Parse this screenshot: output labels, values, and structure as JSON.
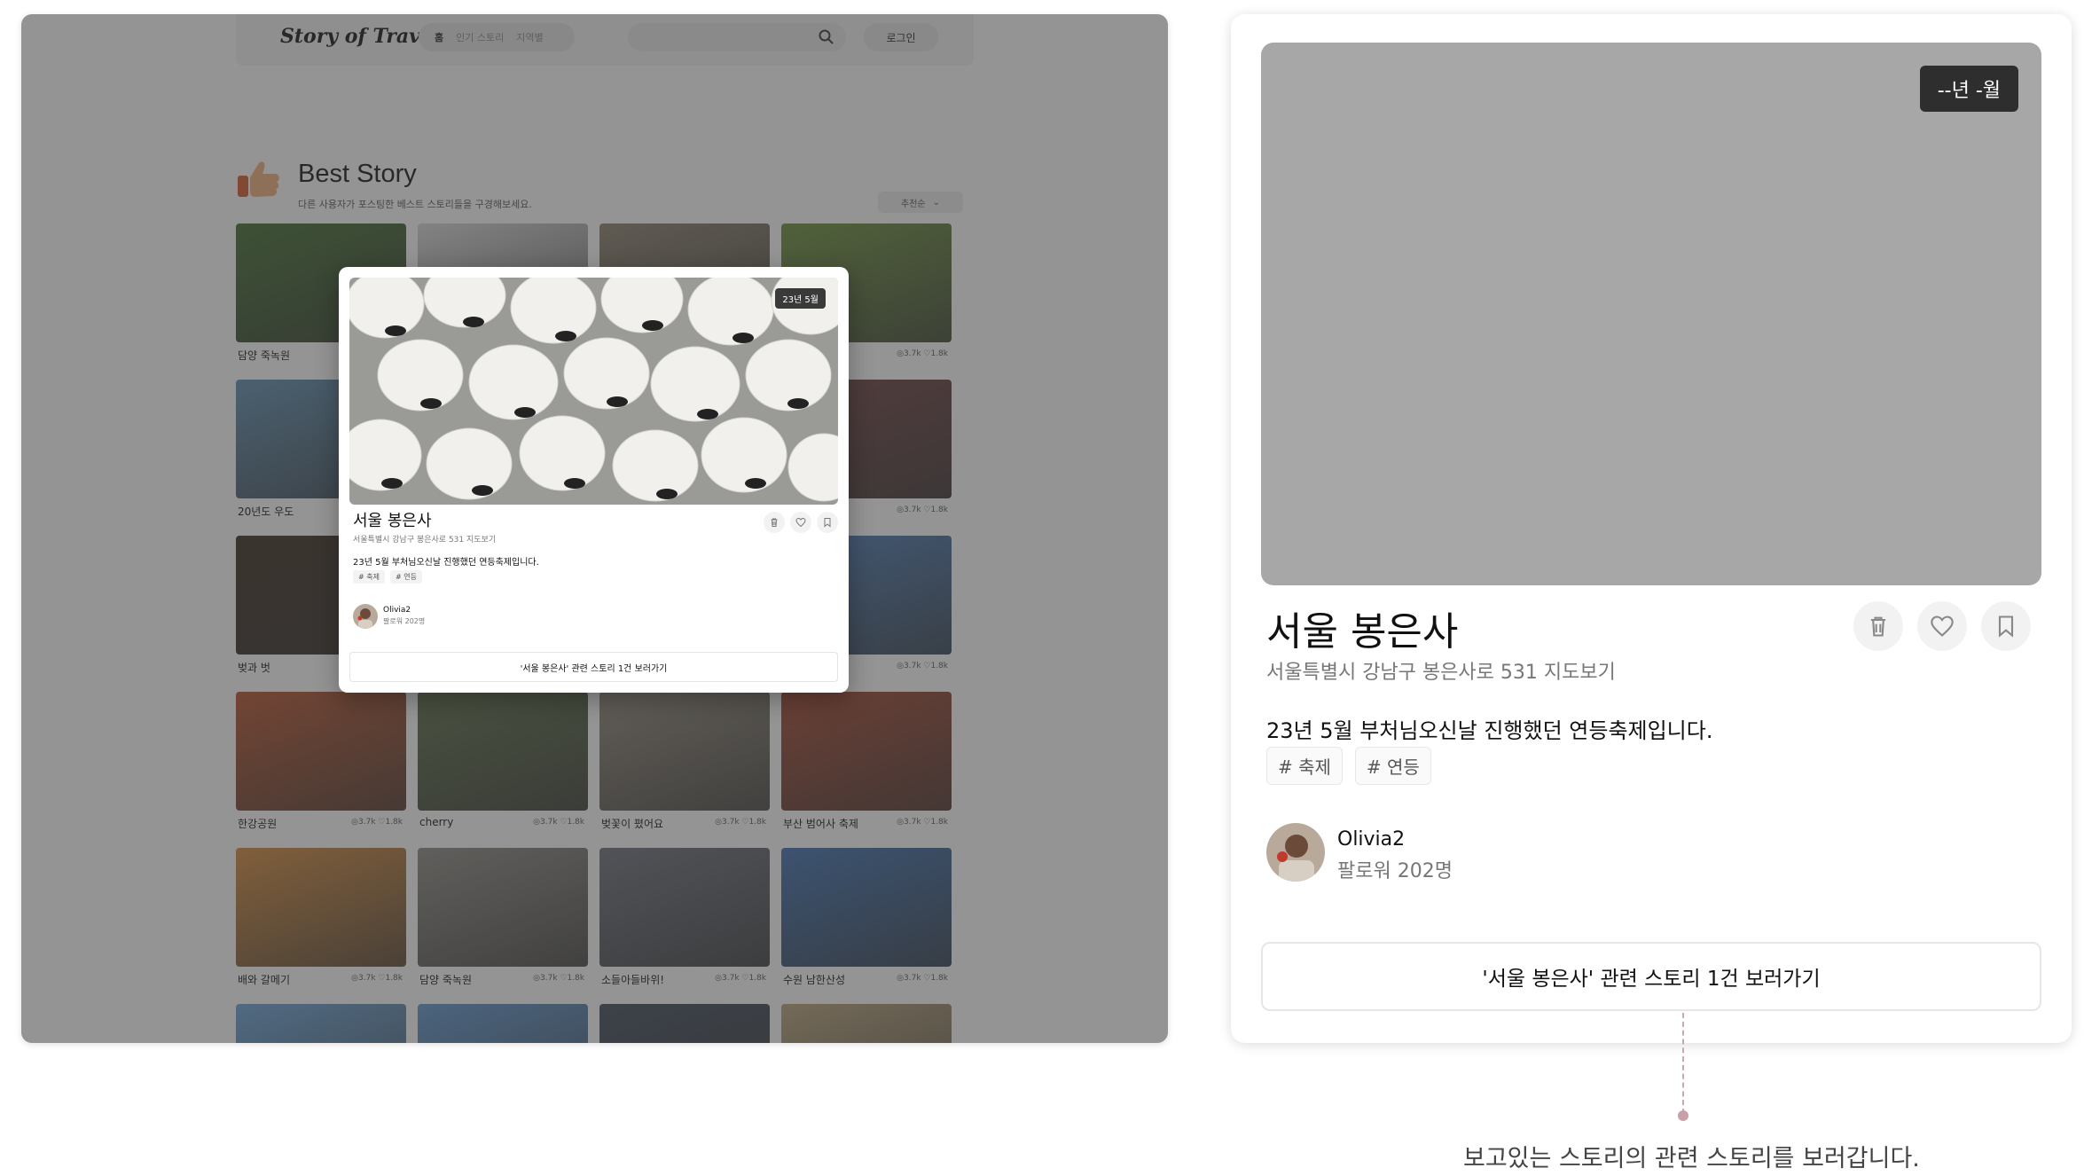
{
  "left": {
    "nav": {
      "logo": "Story of Travel",
      "tabs": [
        "홈",
        "인기 스토리",
        "지역별"
      ],
      "login_label": "로그인"
    },
    "best": {
      "title": "Best Story",
      "subtitle": "다른 사용자가 포스팅한 베스트 스토리들을 구경해보세요.",
      "sort_label": "추천순"
    },
    "cards": [
      {
        "title": "담양 죽녹원",
        "stats": "",
        "color": "#3f6b2e"
      },
      {
        "title": "",
        "stats": "",
        "color": "#d9d9d9"
      },
      {
        "title": "",
        "stats": "",
        "color": "#8b7f6d"
      },
      {
        "title": "",
        "stats": "◎3.7k ♡1.8k",
        "color": "#6b8f3a"
      },
      {
        "title": "20년도 우도",
        "stats": "",
        "color": "#5e8db0"
      },
      {
        "title": "",
        "stats": "",
        "color": "#c2c2c2"
      },
      {
        "title": "",
        "stats": "",
        "color": "#c2c2c2"
      },
      {
        "title": "",
        "stats": "◎3.7k ♡1.8k",
        "color": "#6e3e3e"
      },
      {
        "title": "벚과 벗",
        "stats": "",
        "color": "#3a2a1e"
      },
      {
        "title": "",
        "stats": "",
        "color": "#c2c2c2"
      },
      {
        "title": "",
        "stats": "",
        "color": "#c2c2c2"
      },
      {
        "title": "",
        "stats": "◎3.7k ♡1.8k",
        "color": "#4b7cb8"
      },
      {
        "title": "한강공원",
        "stats": "◎3.7k ♡1.8k",
        "color": "#b5512c"
      },
      {
        "title": "cherry",
        "stats": "◎3.7k ♡1.8k",
        "color": "#5a6b45"
      },
      {
        "title": "벚꽃이 폈어요",
        "stats": "◎3.7k ♡1.8k",
        "color": "#8f8678"
      },
      {
        "title": "부산 범어사 축제",
        "stats": "◎3.7k ♡1.8k",
        "color": "#a2442e"
      },
      {
        "title": "배와 갈메기",
        "stats": "◎3.7k ♡1.8k",
        "color": "#d48a3c"
      },
      {
        "title": "담양 죽녹원",
        "stats": "◎3.7k ♡1.8k",
        "color": "#8d8a84"
      },
      {
        "title": "소들아들바위!",
        "stats": "◎3.7k ♡1.8k",
        "color": "#6a6f7a"
      },
      {
        "title": "수원 남한산성",
        "stats": "◎3.7k ♡1.8k",
        "color": "#3d6fb0"
      },
      {
        "title": "",
        "stats": "",
        "color": "#6ba3d8"
      },
      {
        "title": "",
        "stats": "",
        "color": "#5f95cf"
      },
      {
        "title": "",
        "stats": "",
        "color": "#3e4a5a"
      },
      {
        "title": "",
        "stats": "",
        "color": "#b8a27a"
      }
    ],
    "modal": {
      "date": "23년 5월",
      "title": "서울 봉은사",
      "address": "서울특별시 강남구 봉은사로 531",
      "map_link": "지도보기",
      "description": "23년 5월 부처님오신날 진행했던 연등축제입니다.",
      "tags": [
        "# 축제",
        "# 연등"
      ],
      "author": "Olivia2",
      "followers": "팔로워 202명",
      "related_label": "'서울 봉은사' 관련 스토리 1건 보러가기"
    }
  },
  "right": {
    "date": "--년 -월",
    "title": "서울 봉은사",
    "address": "서울특별시 강남구 봉은사로 531",
    "map_link": "지도보기",
    "description": "23년 5월 부처님오신날 진행했던 연등축제입니다.",
    "tags": [
      "# 축제",
      "# 연등"
    ],
    "author": "Olivia2",
    "followers": "팔로워 202명",
    "related_label": "'서울 봉은사' 관련 스토리 1건 보러가기"
  },
  "caption": "보고있는 스토리의 관련 스토리를 보러갑니다."
}
